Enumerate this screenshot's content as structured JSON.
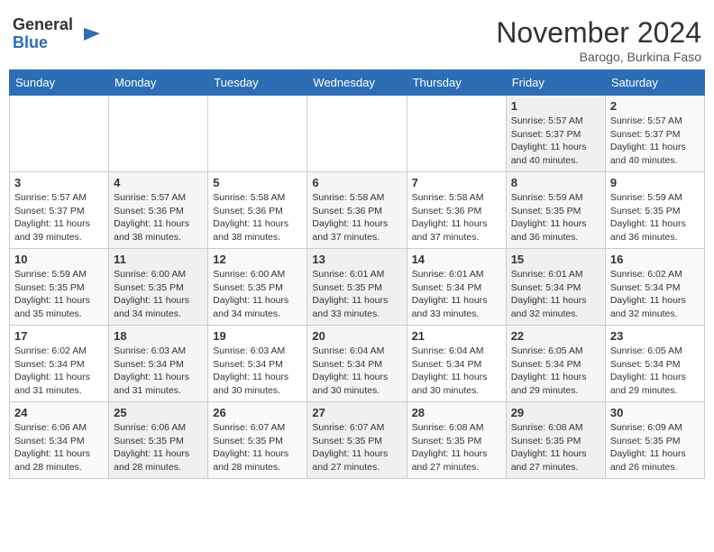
{
  "header": {
    "logo_general": "General",
    "logo_blue": "Blue",
    "month": "November 2024",
    "location": "Barogo, Burkina Faso"
  },
  "weekdays": [
    "Sunday",
    "Monday",
    "Tuesday",
    "Wednesday",
    "Thursday",
    "Friday",
    "Saturday"
  ],
  "weeks": [
    [
      {
        "day": "",
        "info": ""
      },
      {
        "day": "",
        "info": ""
      },
      {
        "day": "",
        "info": ""
      },
      {
        "day": "",
        "info": ""
      },
      {
        "day": "",
        "info": ""
      },
      {
        "day": "1",
        "info": "Sunrise: 5:57 AM\nSunset: 5:37 PM\nDaylight: 11 hours\nand 40 minutes."
      },
      {
        "day": "2",
        "info": "Sunrise: 5:57 AM\nSunset: 5:37 PM\nDaylight: 11 hours\nand 40 minutes."
      }
    ],
    [
      {
        "day": "3",
        "info": "Sunrise: 5:57 AM\nSunset: 5:37 PM\nDaylight: 11 hours\nand 39 minutes."
      },
      {
        "day": "4",
        "info": "Sunrise: 5:57 AM\nSunset: 5:36 PM\nDaylight: 11 hours\nand 38 minutes."
      },
      {
        "day": "5",
        "info": "Sunrise: 5:58 AM\nSunset: 5:36 PM\nDaylight: 11 hours\nand 38 minutes."
      },
      {
        "day": "6",
        "info": "Sunrise: 5:58 AM\nSunset: 5:36 PM\nDaylight: 11 hours\nand 37 minutes."
      },
      {
        "day": "7",
        "info": "Sunrise: 5:58 AM\nSunset: 5:36 PM\nDaylight: 11 hours\nand 37 minutes."
      },
      {
        "day": "8",
        "info": "Sunrise: 5:59 AM\nSunset: 5:35 PM\nDaylight: 11 hours\nand 36 minutes."
      },
      {
        "day": "9",
        "info": "Sunrise: 5:59 AM\nSunset: 5:35 PM\nDaylight: 11 hours\nand 36 minutes."
      }
    ],
    [
      {
        "day": "10",
        "info": "Sunrise: 5:59 AM\nSunset: 5:35 PM\nDaylight: 11 hours\nand 35 minutes."
      },
      {
        "day": "11",
        "info": "Sunrise: 6:00 AM\nSunset: 5:35 PM\nDaylight: 11 hours\nand 34 minutes."
      },
      {
        "day": "12",
        "info": "Sunrise: 6:00 AM\nSunset: 5:35 PM\nDaylight: 11 hours\nand 34 minutes."
      },
      {
        "day": "13",
        "info": "Sunrise: 6:01 AM\nSunset: 5:35 PM\nDaylight: 11 hours\nand 33 minutes."
      },
      {
        "day": "14",
        "info": "Sunrise: 6:01 AM\nSunset: 5:34 PM\nDaylight: 11 hours\nand 33 minutes."
      },
      {
        "day": "15",
        "info": "Sunrise: 6:01 AM\nSunset: 5:34 PM\nDaylight: 11 hours\nand 32 minutes."
      },
      {
        "day": "16",
        "info": "Sunrise: 6:02 AM\nSunset: 5:34 PM\nDaylight: 11 hours\nand 32 minutes."
      }
    ],
    [
      {
        "day": "17",
        "info": "Sunrise: 6:02 AM\nSunset: 5:34 PM\nDaylight: 11 hours\nand 31 minutes."
      },
      {
        "day": "18",
        "info": "Sunrise: 6:03 AM\nSunset: 5:34 PM\nDaylight: 11 hours\nand 31 minutes."
      },
      {
        "day": "19",
        "info": "Sunrise: 6:03 AM\nSunset: 5:34 PM\nDaylight: 11 hours\nand 30 minutes."
      },
      {
        "day": "20",
        "info": "Sunrise: 6:04 AM\nSunset: 5:34 PM\nDaylight: 11 hours\nand 30 minutes."
      },
      {
        "day": "21",
        "info": "Sunrise: 6:04 AM\nSunset: 5:34 PM\nDaylight: 11 hours\nand 30 minutes."
      },
      {
        "day": "22",
        "info": "Sunrise: 6:05 AM\nSunset: 5:34 PM\nDaylight: 11 hours\nand 29 minutes."
      },
      {
        "day": "23",
        "info": "Sunrise: 6:05 AM\nSunset: 5:34 PM\nDaylight: 11 hours\nand 29 minutes."
      }
    ],
    [
      {
        "day": "24",
        "info": "Sunrise: 6:06 AM\nSunset: 5:34 PM\nDaylight: 11 hours\nand 28 minutes."
      },
      {
        "day": "25",
        "info": "Sunrise: 6:06 AM\nSunset: 5:35 PM\nDaylight: 11 hours\nand 28 minutes."
      },
      {
        "day": "26",
        "info": "Sunrise: 6:07 AM\nSunset: 5:35 PM\nDaylight: 11 hours\nand 28 minutes."
      },
      {
        "day": "27",
        "info": "Sunrise: 6:07 AM\nSunset: 5:35 PM\nDaylight: 11 hours\nand 27 minutes."
      },
      {
        "day": "28",
        "info": "Sunrise: 6:08 AM\nSunset: 5:35 PM\nDaylight: 11 hours\nand 27 minutes."
      },
      {
        "day": "29",
        "info": "Sunrise: 6:08 AM\nSunset: 5:35 PM\nDaylight: 11 hours\nand 27 minutes."
      },
      {
        "day": "30",
        "info": "Sunrise: 6:09 AM\nSunset: 5:35 PM\nDaylight: 11 hours\nand 26 minutes."
      }
    ]
  ]
}
